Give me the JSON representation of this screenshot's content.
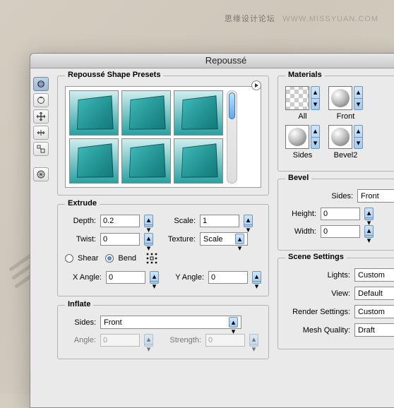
{
  "watermark": {
    "cn": "思缘设计论坛",
    "en": "WWW.MISSYUAN.COM"
  },
  "window": {
    "title": "Repoussé"
  },
  "presets": {
    "legend": "Repoussé Shape Presets"
  },
  "extrude": {
    "legend": "Extrude",
    "depth_label": "Depth:",
    "depth": "0.2",
    "scale_label": "Scale:",
    "scale": "1",
    "twist_label": "Twist:",
    "twist": "0",
    "texture_label": "Texture:",
    "texture": "Scale",
    "shear_label": "Shear",
    "bend_label": "Bend",
    "xangle_label": "X Angle:",
    "xangle": "0",
    "yangle_label": "Y Angle:",
    "yangle": "0"
  },
  "inflate": {
    "legend": "Inflate",
    "sides_label": "Sides:",
    "sides": "Front",
    "angle_label": "Angle:",
    "angle": "0",
    "strength_label": "Strength:",
    "strength": "0"
  },
  "materials": {
    "legend": "Materials",
    "all": "All",
    "front": "Front",
    "sides": "Sides",
    "bevel2": "Bevel2"
  },
  "bevel": {
    "legend": "Bevel",
    "sides_label": "Sides:",
    "sides": "Front",
    "height_label": "Height:",
    "height": "0",
    "width_label": "Width:",
    "width": "0"
  },
  "scene": {
    "legend": "Scene Settings",
    "lights_label": "Lights:",
    "lights": "Custom",
    "view_label": "View:",
    "view": "Default",
    "render_label": "Render Settings:",
    "render": "Custom",
    "mesh_label": "Mesh Quality:",
    "mesh": "Draft"
  }
}
